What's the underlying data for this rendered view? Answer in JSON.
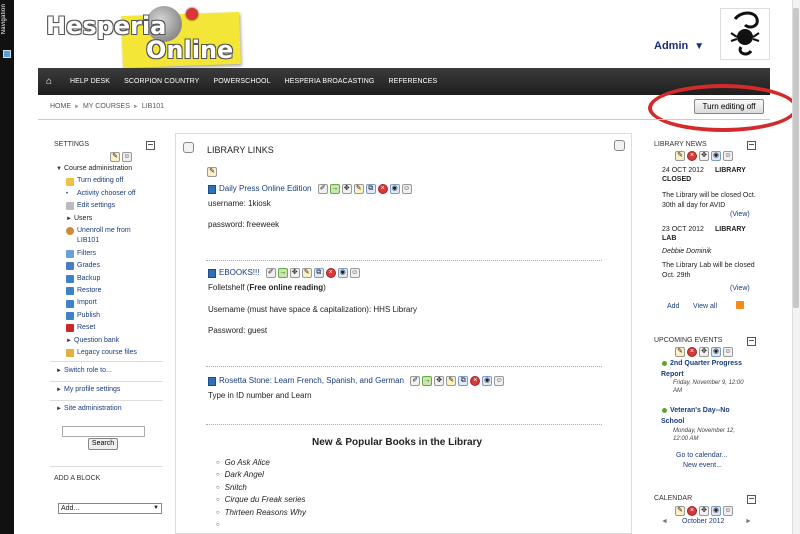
{
  "nav_strip": {
    "label": "Navigation"
  },
  "header": {
    "logo_line1": "Hesperia",
    "logo_line2": "Online",
    "user": "Admin",
    "user_caret": "▼"
  },
  "navbar": {
    "home_icon": "home-icon",
    "items": [
      "HELP DESK",
      "SCORPION COUNTRY",
      "POWERSCHOOL",
      "HESPERIA BROACASTING",
      "REFERENCES"
    ]
  },
  "breadcrumb": {
    "items": [
      "HOME",
      "MY COURSES",
      "LIB101"
    ],
    "separator": "►"
  },
  "turn_editing_button": "Turn editing off",
  "settings": {
    "title": "SETTINGS",
    "course_admin": "Course administration",
    "items": [
      "Turn editing off",
      "Activity chooser off",
      "Edit settings",
      "Users",
      "Unenroll me from",
      "LIB101",
      "Filters",
      "Grades",
      "Backup",
      "Restore",
      "Import",
      "Publish",
      "Reset",
      "Question bank",
      "Legacy course files"
    ],
    "switch_role": "Switch role to...",
    "profile_settings": "My profile settings",
    "site_admin": "Site administration",
    "search_button": "Search"
  },
  "add_block": {
    "title": "ADD A BLOCK",
    "select_value": "Add..."
  },
  "main": {
    "section_title": "LIBRARY LINKS",
    "resources": [
      {
        "title": "Daily Press Online Edition",
        "lines": [
          "username: 1kiosk",
          "password: freeweek"
        ]
      },
      {
        "title": "EBOOKS!!!",
        "line1_prefix": "Folletshelf (",
        "line1_bold": "Free online reading",
        "line1_suffix": ")",
        "lines": [
          "Username (must have space & capitalization): HHS Library",
          "Password: guest"
        ]
      },
      {
        "title": "Rosetta Stone: Learn French, Spanish, and German",
        "lines": [
          "Type in ID number and Learn"
        ]
      }
    ],
    "books_heading": "New & Popular Books in the Library",
    "books": [
      "Go Ask Alice",
      "Dark Angel",
      "Snitch",
      "Cirque du Freak series",
      "Thirteen Reasons Why",
      ""
    ]
  },
  "library_news": {
    "title": "LIBRARY NEWS",
    "posts": [
      {
        "date": "24 OCT 2012",
        "heading1": "LIBRARY",
        "heading2": "CLOSED",
        "author": "",
        "body": "The Library will be closed Oct. 30th all day for AVID",
        "view": "(View)"
      },
      {
        "date": "23 OCT 2012",
        "heading1": "LIBRARY",
        "heading2": "LAB",
        "author": "Debbie Dominik",
        "body": "The Library Lab will be closed Oct. 29th",
        "view": "(View)"
      }
    ],
    "add": "Add",
    "view_all": "View all"
  },
  "upcoming_events": {
    "title": "UPCOMING EVENTS",
    "events": [
      {
        "name1": "2nd Quarter Progress",
        "name2": "Report",
        "when": "Friday, November 9, 12:00",
        "when2": "AM"
      },
      {
        "name1": "Veteran's Day--No",
        "name2": "School",
        "when": "Monday, November 12,",
        "when2": "12:00 AM"
      }
    ],
    "go_calendar": "Go to calendar...",
    "new_event": "New event..."
  },
  "calendar": {
    "title": "CALENDAR",
    "month": "October 2012",
    "prev": "◄",
    "next": "►"
  },
  "colors": {
    "navbar": "#2b2b2b",
    "link": "#1a3d7a",
    "highlight_circle": "#d42a2a",
    "sticky_note": "#f4e636"
  }
}
